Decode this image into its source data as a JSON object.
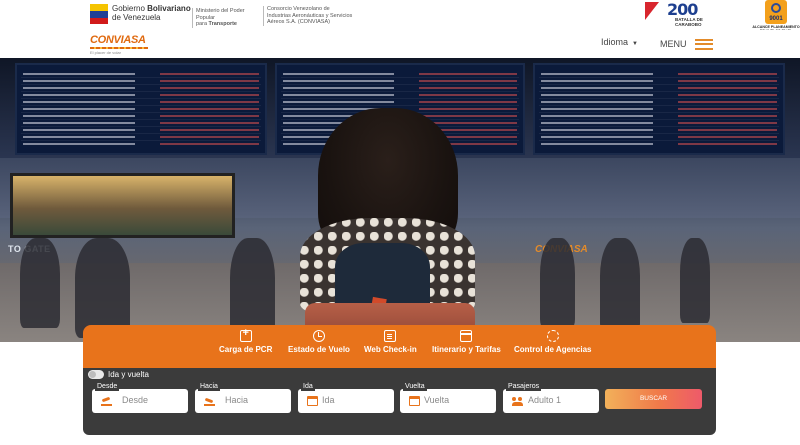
{
  "government": {
    "title_line1": "Gobierno ",
    "title_bold": "Bolivariano",
    "title_line2": "de Venezuela",
    "ministry_line1": "Ministerio del Poder Popular",
    "ministry_line2": "para ",
    "ministry_bold": "Transporte",
    "consorcio": "Consorcio Venezolano de Industrias Aeronáuticas y Servicios Aéreos S.A. (CONVIASA)"
  },
  "carabobo": {
    "number": "200",
    "subtitle_line1": "BATALLA DE",
    "subtitle_line2": "CARABOBO"
  },
  "iso": {
    "number": "9001",
    "text": "ALCANCE PLANEAMIENTO DE VUELOS EN EL AEROPUERTO INTERNACIONAL DE MAIQUETÍA"
  },
  "nav": {
    "logo": "CONVIASA",
    "logo_tag": "El placer de volar",
    "idioma_label": "Idioma",
    "menu_label": "MENU"
  },
  "hero": {
    "gate_sign": "TO GATE",
    "airline_sign": "CONVIASA"
  },
  "tabs": [
    {
      "label": "Carga de PCR",
      "icon": "medical-kit-icon"
    },
    {
      "label": "Estado de Vuelo",
      "icon": "clock-icon"
    },
    {
      "label": "Web Check-in",
      "icon": "document-icon"
    },
    {
      "label": "Itinerario y Tarifas",
      "icon": "calendar-icon"
    },
    {
      "label": "Control de Agencias",
      "icon": "gear-icon"
    }
  ],
  "booking": {
    "roundtrip_label": "Ida y vuelta",
    "fields": [
      {
        "label": "Desde",
        "placeholder": "Desde",
        "icon": "takeoff-icon"
      },
      {
        "label": "Hacia",
        "placeholder": "Hacia",
        "icon": "landing-icon"
      },
      {
        "label": "Ida",
        "placeholder": "Ida",
        "icon": "calendar-icon"
      },
      {
        "label": "Vuelta",
        "placeholder": "Vuelta",
        "icon": "calendar-icon"
      },
      {
        "label": "Pasajeros",
        "placeholder": "Adulto 1",
        "icon": "passengers-icon"
      }
    ],
    "search_label": "BUSCAR"
  },
  "colors": {
    "brand_orange": "#e8731b",
    "panel_dark": "#3b3b3b",
    "menu_accent": "#e38b2a"
  }
}
